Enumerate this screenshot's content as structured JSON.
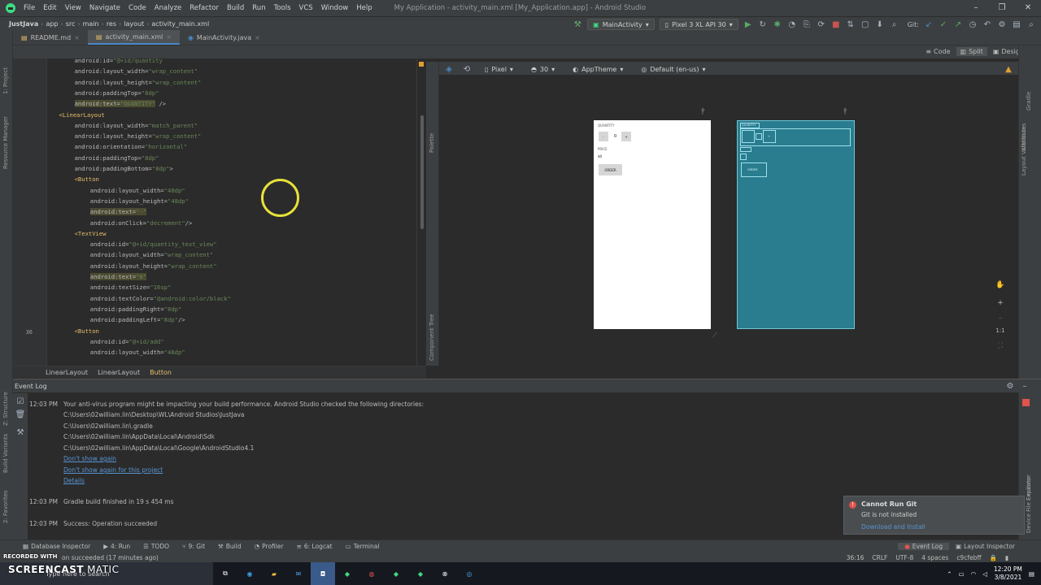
{
  "window": {
    "title": "My Application - activity_main.xml [My_Application.app] - Android Studio",
    "menu": [
      "File",
      "Edit",
      "View",
      "Navigate",
      "Code",
      "Analyze",
      "Refactor",
      "Build",
      "Run",
      "Tools",
      "VCS",
      "Window",
      "Help"
    ]
  },
  "navbar": {
    "crumbs": [
      "JustJava",
      "app",
      "src",
      "main",
      "res",
      "layout",
      "activity_main.xml"
    ],
    "run_config": "MainActivity",
    "device": "Pixel 3 XL API 30",
    "git_label": "Git:"
  },
  "tabs": [
    {
      "label": "README.md",
      "active": false
    },
    {
      "label": "activity_main.xml",
      "active": true
    },
    {
      "label": "MainActivity.java",
      "active": false
    }
  ],
  "view_modes": {
    "code": "Code",
    "split": "Split",
    "design": "Design"
  },
  "design_toolbar": {
    "device": "Pixel",
    "api": "30",
    "theme": "AppTheme",
    "locale": "Default (en-us)"
  },
  "left_strip": [
    "1: Project",
    "Resource Manager"
  ],
  "code_lines": [
    {
      "n": "",
      "indent": 4,
      "parts": [
        [
          "attr",
          "android:id="
        ],
        [
          "val",
          "\"@+id/quantity"
        ]
      ]
    },
    {
      "n": "",
      "indent": 4,
      "parts": [
        [
          "attr",
          "android:layout_width="
        ],
        [
          "val",
          "\"wrap_content\""
        ]
      ]
    },
    {
      "n": "",
      "indent": 4,
      "parts": [
        [
          "attr",
          "android:layout_height="
        ],
        [
          "val",
          "\"wrap_content\""
        ]
      ]
    },
    {
      "n": "",
      "indent": 4,
      "parts": [
        [
          "attr",
          "android:paddingTop="
        ],
        [
          "val",
          "\"8dp\""
        ]
      ]
    },
    {
      "n": "",
      "indent": 4,
      "hl": true,
      "parts": [
        [
          "attr",
          "android:text="
        ],
        [
          "val",
          "\"QUANTITY\""
        ],
        [
          "attr",
          " />"
        ]
      ]
    },
    {
      "n": "",
      "indent": 1,
      "parts": [
        [
          "tag",
          "<LinearLayout"
        ]
      ]
    },
    {
      "n": "",
      "indent": 4,
      "parts": [
        [
          "attr",
          "android:layout_width="
        ],
        [
          "val",
          "\"match_parent\""
        ]
      ]
    },
    {
      "n": "",
      "indent": 4,
      "parts": [
        [
          "attr",
          "android:layout_height="
        ],
        [
          "val",
          "\"wrap_content\""
        ]
      ]
    },
    {
      "n": "",
      "indent": 4,
      "parts": [
        [
          "attr",
          "android:orientation="
        ],
        [
          "val",
          "\"horizontal\""
        ]
      ]
    },
    {
      "n": "",
      "indent": 4,
      "parts": [
        [
          "attr",
          "android:paddingTop="
        ],
        [
          "val",
          "\"8dp\""
        ]
      ]
    },
    {
      "n": "",
      "indent": 4,
      "parts": [
        [
          "attr",
          "android:paddingBottom="
        ],
        [
          "val",
          "\"8dp\""
        ],
        [
          "attr",
          ">"
        ]
      ]
    },
    {
      "n": "",
      "indent": 4,
      "parts": [
        [
          "tag",
          "<Button"
        ]
      ]
    },
    {
      "n": "",
      "indent": 7,
      "parts": [
        [
          "attr",
          "android:layout_width="
        ],
        [
          "val",
          "\"48dp\""
        ]
      ]
    },
    {
      "n": "",
      "indent": 7,
      "parts": [
        [
          "attr",
          "android:layout_height="
        ],
        [
          "val",
          "\"48dp\""
        ]
      ]
    },
    {
      "n": "",
      "indent": 7,
      "hl": true,
      "parts": [
        [
          "attr",
          "android:text="
        ],
        [
          "val",
          "\"-\""
        ]
      ]
    },
    {
      "n": "",
      "indent": 7,
      "parts": [
        [
          "attr",
          "android:onClick="
        ],
        [
          "val",
          "\"decrement\""
        ],
        [
          "attr",
          "/>"
        ]
      ]
    },
    {
      "n": "",
      "indent": 4,
      "parts": [
        [
          "tag",
          "<TextView"
        ]
      ]
    },
    {
      "n": "",
      "indent": 7,
      "parts": [
        [
          "attr",
          "android:id="
        ],
        [
          "val",
          "\"@+id/quantity_text_view\""
        ]
      ]
    },
    {
      "n": "",
      "indent": 7,
      "parts": [
        [
          "attr",
          "android:layout_width="
        ],
        [
          "val",
          "\"wrap_content\""
        ]
      ]
    },
    {
      "n": "",
      "indent": 7,
      "parts": [
        [
          "attr",
          "android:layout_height="
        ],
        [
          "val",
          "\"wrap_content\""
        ]
      ]
    },
    {
      "n": "",
      "indent": 7,
      "hl": true,
      "parts": [
        [
          "attr",
          "android:text="
        ],
        [
          "val",
          "\"0\""
        ]
      ]
    },
    {
      "n": "",
      "indent": 7,
      "parts": [
        [
          "attr",
          "android:textSize="
        ],
        [
          "val",
          "\"16sp\""
        ]
      ]
    },
    {
      "n": "",
      "indent": 7,
      "parts": [
        [
          "attr",
          "android:textColor="
        ],
        [
          "val",
          "\"@android:color/black\""
        ]
      ]
    },
    {
      "n": "",
      "indent": 7,
      "parts": [
        [
          "attr",
          "android:paddingRight="
        ],
        [
          "val",
          "\"8dp\""
        ]
      ]
    },
    {
      "n": "",
      "indent": 7,
      "parts": [
        [
          "attr",
          "android:paddingLeft="
        ],
        [
          "val",
          "\"8dp\""
        ],
        [
          "attr",
          "/>"
        ]
      ]
    },
    {
      "n": "36",
      "indent": 4,
      "parts": [
        [
          "tag",
          "<Button"
        ]
      ]
    },
    {
      "n": "",
      "indent": 7,
      "parts": [
        [
          "attr",
          "android:id="
        ],
        [
          "val",
          "\"@+id/add\""
        ]
      ]
    },
    {
      "n": "",
      "indent": 7,
      "parts": [
        [
          "attr",
          "android:layout_width="
        ],
        [
          "val",
          "\"48dp\""
        ]
      ]
    }
  ],
  "editor_crumb": [
    "LinearLayout",
    "LinearLayout",
    "Button"
  ],
  "preview": {
    "quantity_label": "QUANTITY",
    "minus": "-",
    "qty": "0",
    "plus": "+",
    "price_label": "PRICE",
    "price": "$0",
    "order": "ORDER"
  },
  "event_log": {
    "title": "Event Log",
    "entries": [
      {
        "time": "12:03 PM",
        "text": "Your anti-virus program might be impacting your build performance. Android Studio checked the following directories:"
      },
      {
        "time": "",
        "text": "C:\\Users\\02william.lin\\Desktop\\WL\\Android Studios\\JustJava"
      },
      {
        "time": "",
        "text": "C:\\Users\\02william.lin\\.gradle"
      },
      {
        "time": "",
        "text": "C:\\Users\\02william.lin\\AppData\\Local\\Android\\Sdk"
      },
      {
        "time": "",
        "text": "C:\\Users\\02william.lin\\AppData\\Local\\Google\\AndroidStudio4.1"
      }
    ],
    "links": [
      "Don't show again",
      "Don't show again for this project",
      "Details"
    ],
    "gradle_time": "12:03 PM",
    "gradle_text": "Gradle build finished in 19 s 454 ms",
    "success_time": "12:03 PM",
    "success_text": "Success: Operation succeeded"
  },
  "notification": {
    "title": "Cannot Run Git",
    "body": "Git is not installed",
    "link": "Download and Install"
  },
  "bottom_tools": [
    "Database Inspector",
    "4: Run",
    "TODO",
    "9: Git",
    "Build",
    "Profiler",
    "6: Logcat",
    "Terminal"
  ],
  "bottom_right_tools": [
    "Event Log",
    "Layout Inspector"
  ],
  "status": {
    "message": "on succeeded (17 minutes ago)",
    "position": "36:16",
    "line_sep": "CRLF",
    "encoding": "UTF-8",
    "indent": "4 spaces",
    "branch": "c9cfebff"
  },
  "watermark": {
    "brand": "SCREENCAST",
    "suffix": "MATIC",
    "recorded": "RECORDED WITH"
  },
  "taskbar": {
    "search": "Type here to search",
    "time": "12:20 PM",
    "date": "3/8/2021"
  }
}
